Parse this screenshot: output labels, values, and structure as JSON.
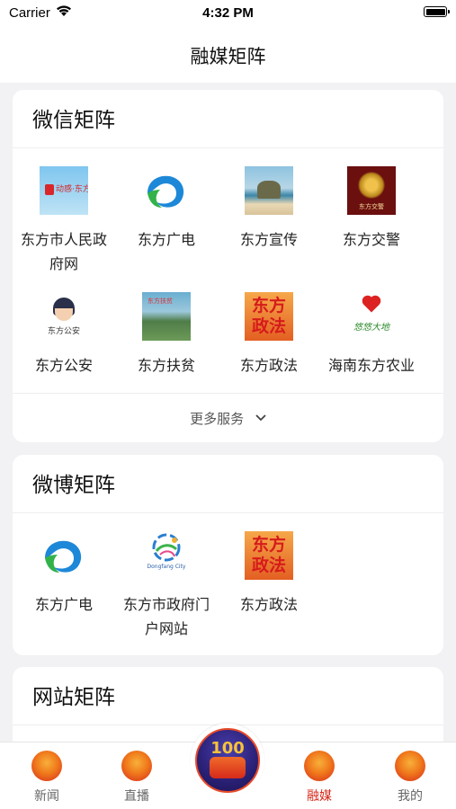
{
  "status_bar": {
    "carrier": "Carrier",
    "time": "4:32 PM"
  },
  "nav": {
    "title": "融媒矩阵"
  },
  "wechat": {
    "title": "微信矩阵",
    "items": [
      {
        "label": "东方市人民政府网",
        "logo": "gov-site-logo",
        "logo_text": "动感·东方"
      },
      {
        "label": "东方广电",
        "logo": "broadcast-logo"
      },
      {
        "label": "东方宣传",
        "logo": "seaside-photo-logo"
      },
      {
        "label": "东方交警",
        "logo": "traffic-police-badge-logo",
        "logo_text": "东方交警"
      },
      {
        "label": "东方公安",
        "logo": "police-cartoon-logo",
        "logo_text": "东方公安"
      },
      {
        "label": "东方扶贫",
        "logo": "poverty-relief-photo-logo",
        "logo_text": "东方扶贫"
      },
      {
        "label": "东方政法",
        "logo": "politics-law-logo",
        "logo_text": "东方政法"
      },
      {
        "label": "海南东方农业",
        "logo": "agriculture-logo",
        "logo_text": "悠悠大地"
      }
    ],
    "more_label": "更多服务"
  },
  "weibo": {
    "title": "微博矩阵",
    "items": [
      {
        "label": "东方广电",
        "logo": "broadcast-logo"
      },
      {
        "label": "东方市政府门户网站",
        "logo": "gov-portal-logo",
        "logo_text": "Dongfang City"
      },
      {
        "label": "东方政法",
        "logo": "politics-law-logo",
        "logo_text": "东方政法"
      }
    ]
  },
  "website": {
    "title": "网站矩阵"
  },
  "tabs": [
    {
      "label": "新闻",
      "icon": "news-tab-icon",
      "active": false
    },
    {
      "label": "直播",
      "icon": "live-tab-icon",
      "active": false
    },
    {
      "label": "融媒",
      "icon": "media-tab-icon",
      "active": true
    },
    {
      "label": "我的",
      "icon": "profile-tab-icon",
      "active": false
    }
  ],
  "center_tab": {
    "icon": "centenary-cake-icon",
    "text": "100"
  },
  "colors": {
    "accent": "#d62a1a",
    "background": "#f2f2f4",
    "card": "#ffffff"
  }
}
